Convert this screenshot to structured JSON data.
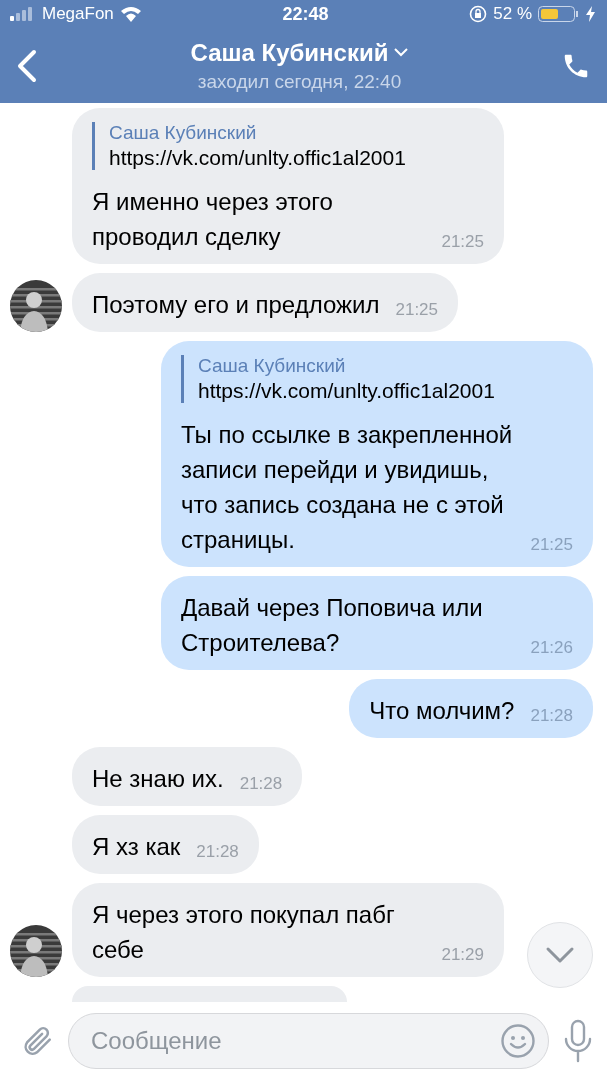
{
  "status_bar": {
    "carrier": "MegaFon",
    "time": "22:48",
    "battery": "52 %"
  },
  "header": {
    "title": "Саша Кубинский",
    "subtitle": "заходил сегодня, 22:40"
  },
  "messages": [
    {
      "kind": "incoming",
      "avatar": false,
      "quote": {
        "author": "Саша Кубинский",
        "text": "https://vk.com/unlty.offic1al2001"
      },
      "text": "Я именно через этого проводил сделку",
      "time": "21:25"
    },
    {
      "kind": "incoming",
      "avatar": true,
      "text": "Поэтому его и предложил",
      "time": "21:25"
    },
    {
      "kind": "outgoing",
      "quote": {
        "author": "Саша Кубинский",
        "text": "https://vk.com/unlty.offic1al2001"
      },
      "text": "Ты по ссылке в закрепленной записи перейди и увидишь, что запись создана не с этой страницы.",
      "time": "21:25"
    },
    {
      "kind": "outgoing",
      "text": "Давай через Поповича или Строителева?",
      "time": "21:26"
    },
    {
      "kind": "outgoing",
      "text": "Что молчим?",
      "time": "21:28"
    },
    {
      "kind": "incoming",
      "avatar": false,
      "text": "Не знаю их.",
      "time": "21:28"
    },
    {
      "kind": "incoming",
      "avatar": false,
      "text": "Я хз как",
      "time": "21:28"
    },
    {
      "kind": "incoming",
      "avatar": true,
      "text": "Я через этого покупал пабг себе",
      "time": "21:29"
    },
    {
      "kind": "cut"
    }
  ],
  "composer": {
    "placeholder": "Сообщение"
  }
}
